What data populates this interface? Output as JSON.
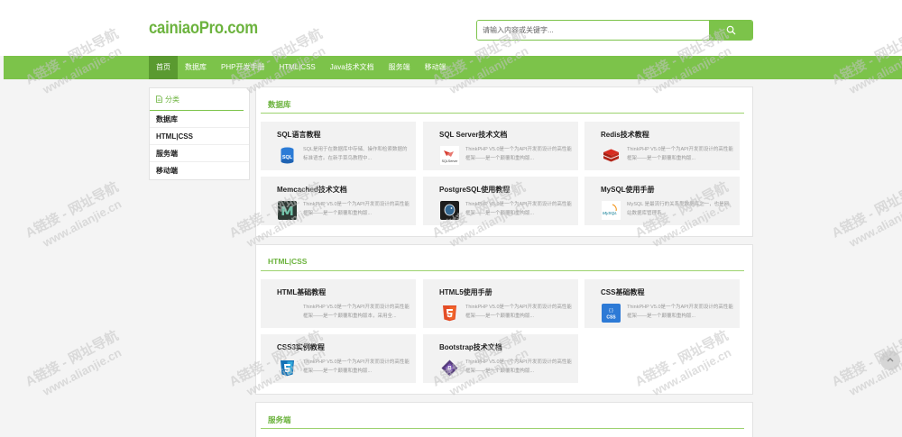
{
  "header": {
    "logo": "cainiaoPro.com",
    "search": {
      "placeholder": "请输入内容或关键字...",
      "value": ""
    }
  },
  "nav": {
    "items": [
      {
        "label": "首页",
        "active": true
      },
      {
        "label": "数据库",
        "active": false
      },
      {
        "label": "PHP开发手册",
        "active": false
      },
      {
        "label": "HTML|CSS",
        "active": false
      },
      {
        "label": "Java技术文档",
        "active": false
      },
      {
        "label": "服务端",
        "active": false
      },
      {
        "label": "移动端",
        "active": false
      }
    ]
  },
  "sidebar": {
    "heading": "分类",
    "items": [
      {
        "label": "数据库"
      },
      {
        "label": "HTML|CSS"
      },
      {
        "label": "服务端"
      },
      {
        "label": "移动端"
      }
    ]
  },
  "sections": [
    {
      "title": "数据库",
      "cards": [
        {
          "title": "SQL语言教程",
          "icon": "sql-icon",
          "desc": "SQL是用于在数据库中存储、操作和检索数据的标准语言。在新手菜鸟教程中..."
        },
        {
          "title": "SQL Server技术文档",
          "icon": "sql-server-icon",
          "icon_label": "SQLServer",
          "desc": "ThinkPHP V5.0是一个为API开发而设计的高性能框架——是一个颠覆和重构版..."
        },
        {
          "title": "Redis技术教程",
          "icon": "redis-icon",
          "desc": "ThinkPHP V5.0是一个为API开发而设计的高性能框架——是一个颠覆和重构版..."
        },
        {
          "title": "Memcached技术文档",
          "icon": "memcached-icon",
          "desc": "ThinkPHP V5.0是一个为API开发而设计的高性能框架——是一个颠覆和重构版..."
        },
        {
          "title": "PostgreSQL使用教程",
          "icon": "postgresql-icon",
          "desc": "ThinkPHP V5.0是一个为API开发而设计的高性能框架——是一个颠覆和重构版..."
        },
        {
          "title": "MySQL使用手册",
          "icon": "mysql-icon",
          "icon_label": "MySQL",
          "desc": "MySQL 是最流行的关系型数据库之一，也是网站数据库管理系..."
        }
      ]
    },
    {
      "title": "HTML|CSS",
      "cards": [
        {
          "title": "HTML基础教程",
          "icon": "",
          "desc": "ThinkPHP V5.0是一个为API开发而设计的高性能框架——是一个颠覆和重构版本，采用全..."
        },
        {
          "title": "HTML5使用手册",
          "icon": "html5-icon",
          "desc": "ThinkPHP V5.0是一个为API开发而设计的高性能框架——是一个颠覆和重构版..."
        },
        {
          "title": "CSS基础教程",
          "icon": "css-icon",
          "icon_label": "CSS",
          "desc": "ThinkPHP V5.0是一个为API开发而设计的高性能框架——是一个颠覆和重构版..."
        },
        {
          "title": "CSS3实例教程",
          "icon": "css3-icon",
          "desc": "ThinkPHP V5.0是一个为API开发而设计的高性能框架——是一个颠覆和重构版..."
        },
        {
          "title": "Bootstrap技术文档",
          "icon": "bootstrap-icon",
          "desc": "ThinkPHP V5.0是一个为API开发而设计的高性能框架——是一个颠覆和重构版..."
        }
      ]
    },
    {
      "title": "服务端",
      "cards": []
    }
  ],
  "watermark": {
    "line1": "A链接 - 网址导航",
    "line2": "www.alianjie.cn"
  },
  "colors": {
    "brand": "#7cc34a",
    "brand_dark": "#5a9a30",
    "title_green": "#6cb33e"
  }
}
